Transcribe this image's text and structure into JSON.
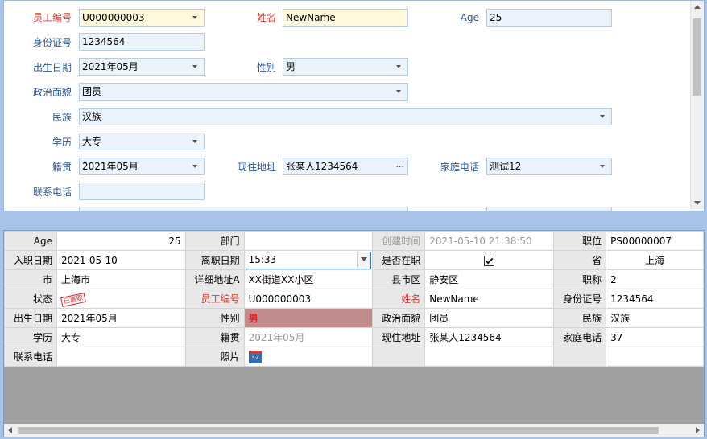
{
  "form": {
    "employee_no": {
      "label": "员工编号",
      "value": "U000000003"
    },
    "name": {
      "label": "姓名",
      "value": "NewName"
    },
    "age": {
      "label": "Age",
      "value": "25"
    },
    "id_no": {
      "label": "身份证号",
      "value": "1234564"
    },
    "birth": {
      "label": "出生日期",
      "value": "2021年05月"
    },
    "gender": {
      "label": "性别",
      "value": "男"
    },
    "politics": {
      "label": "政治面貌",
      "value": "团员"
    },
    "ethnic": {
      "label": "民族",
      "value": "汉族"
    },
    "education": {
      "label": "学历",
      "value": "大专"
    },
    "native": {
      "label": "籍贯",
      "value": "2021年05月"
    },
    "address": {
      "label": "现住地址",
      "value": "张某人1234564",
      "button": "..."
    },
    "home_phone": {
      "label": "家庭电话",
      "value": "测试12"
    },
    "contact_phone": {
      "label": "联系电话",
      "value": ""
    }
  },
  "grid": {
    "rows": [
      [
        {
          "k": "Age"
        },
        {
          "v": "25",
          "cls": "num"
        },
        {
          "k": "部门"
        },
        {
          "v": ""
        },
        {
          "k": "创建时间",
          "cls": "dis"
        },
        {
          "v": "2021-05-10 21:38:50",
          "cls": "dis"
        },
        {
          "k": "职位"
        },
        {
          "v": "PS00000007"
        }
      ],
      [
        {
          "k": "入职日期"
        },
        {
          "v": "2021-05-10"
        },
        {
          "k": "离职日期"
        },
        {
          "v": "15:33",
          "edit": true
        },
        {
          "k": "是否在职"
        },
        {
          "v": "",
          "check": true
        },
        {
          "k": "省"
        },
        {
          "v": "上海",
          "cls": "center"
        }
      ],
      [
        {
          "k": "市"
        },
        {
          "v": "上海市"
        },
        {
          "k": "详细地址A"
        },
        {
          "v": "XX街道XX小区"
        },
        {
          "k": "县市区"
        },
        {
          "v": "静安区"
        },
        {
          "k": "职称"
        },
        {
          "v": "2"
        }
      ],
      [
        {
          "k": "状态"
        },
        {
          "v": "",
          "stamp": "已离职"
        },
        {
          "k": "员工编号",
          "cls": "req"
        },
        {
          "v": "U000000003"
        },
        {
          "k": "姓名",
          "cls": "req"
        },
        {
          "v": "NewName"
        },
        {
          "k": "身份证号"
        },
        {
          "v": "1234564"
        }
      ],
      [
        {
          "k": "出生日期"
        },
        {
          "v": "2021年05月"
        },
        {
          "k": "性别"
        },
        {
          "v": "男",
          "cls": "red"
        },
        {
          "k": "政治面貌"
        },
        {
          "v": "团员"
        },
        {
          "k": "民族"
        },
        {
          "v": "汉族"
        }
      ],
      [
        {
          "k": "学历"
        },
        {
          "v": "大专"
        },
        {
          "k": "籍贯"
        },
        {
          "v": "2021年05月",
          "cls": "dis"
        },
        {
          "k": "现住地址"
        },
        {
          "v": "张某人1234564"
        },
        {
          "k": "家庭电话"
        },
        {
          "v": "37"
        }
      ],
      [
        {
          "k": "联系电话"
        },
        {
          "v": ""
        },
        {
          "k": "照片"
        },
        {
          "v": "",
          "cal": "32"
        },
        {
          "k": ""
        },
        {
          "v": ""
        },
        {
          "k": ""
        },
        {
          "v": ""
        }
      ]
    ]
  }
}
